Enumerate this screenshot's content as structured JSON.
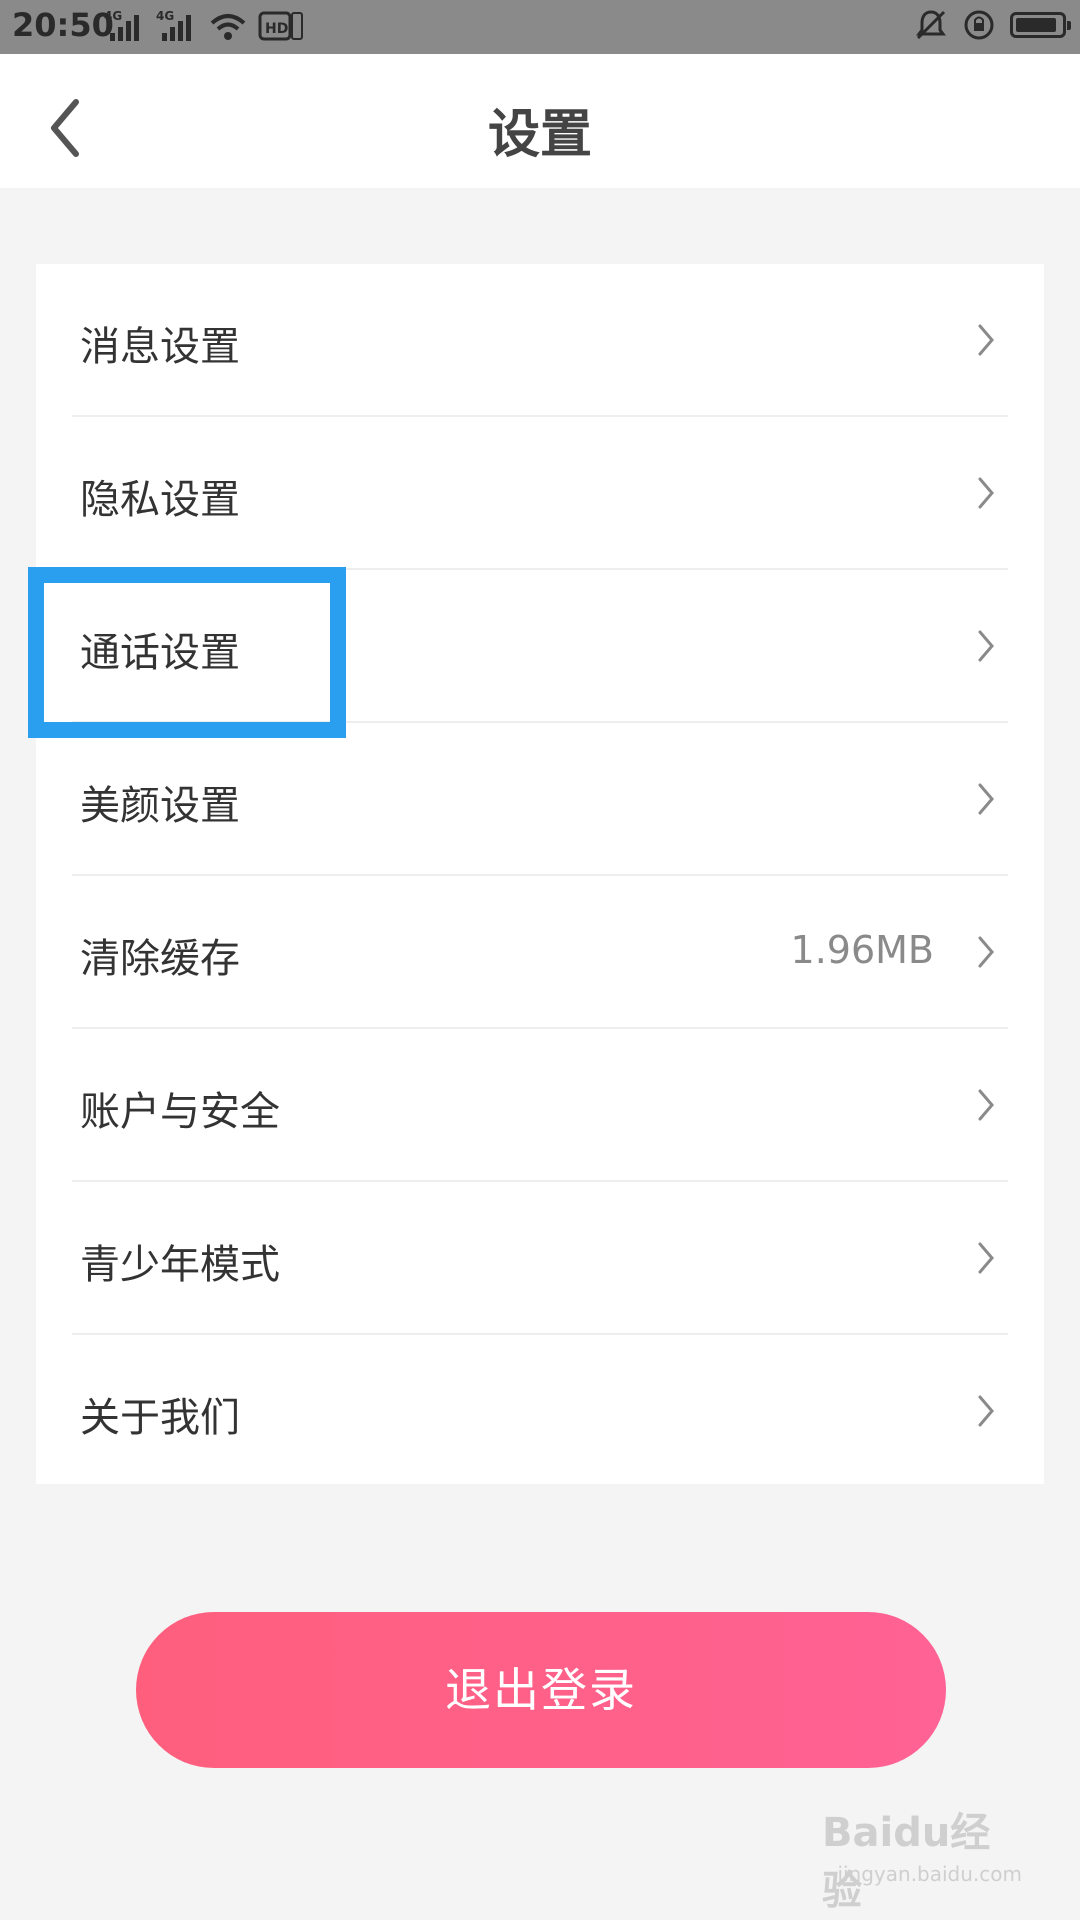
{
  "status_bar": {
    "time": "20:50",
    "network_1": "4G",
    "network_2": "4G",
    "hd_label": "HD",
    "battery_level": 0.9
  },
  "header": {
    "title": "设置"
  },
  "settings": {
    "items": [
      {
        "label": "消息设置",
        "value": ""
      },
      {
        "label": "隐私设置",
        "value": ""
      },
      {
        "label": "通话设置",
        "value": ""
      },
      {
        "label": "美颜设置",
        "value": ""
      },
      {
        "label": "清除缓存",
        "value": "1.96MB"
      },
      {
        "label": "账户与安全",
        "value": ""
      },
      {
        "label": "青少年模式",
        "value": ""
      },
      {
        "label": "关于我们",
        "value": ""
      }
    ]
  },
  "logout": {
    "label": "退出登录"
  },
  "watermark": {
    "brand": "Baidu经验",
    "url": "jingyan.baidu.com"
  },
  "colors": {
    "highlight": "#2a9ff0",
    "logout_start": "#ff5f7d",
    "logout_end": "#ff6294"
  }
}
